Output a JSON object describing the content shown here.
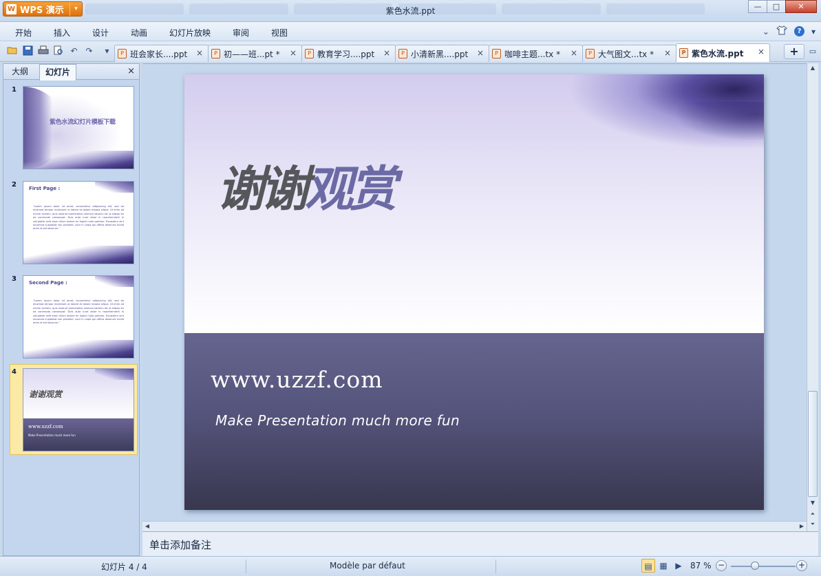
{
  "app": {
    "button_label": "WPS 演示",
    "logo_glyph": "W",
    "window_title": "紫色水流.ppt",
    "accent_color": "#e98a1f"
  },
  "window_controls": {
    "minimize": "—",
    "maximize": "□",
    "close": "✕"
  },
  "menu": {
    "items": [
      "开始",
      "插入",
      "设计",
      "动画",
      "幻灯片放映",
      "审阅",
      "视图"
    ],
    "right_chevron": "⌄",
    "skin_icon": "shirt-icon",
    "help_label": "?"
  },
  "doc_tabs": [
    {
      "label": "班会家长....ppt",
      "active": false
    },
    {
      "label": "初——班...pt *",
      "active": false
    },
    {
      "label": "教育学习....ppt",
      "active": false
    },
    {
      "label": "小清新黑....ppt",
      "active": false
    },
    {
      "label": "咖啡主题...tx *",
      "active": false
    },
    {
      "label": "大气图文...tx *",
      "active": false
    },
    {
      "label": "紫色水流.ppt",
      "active": true
    }
  ],
  "tab_close_glyph": "×",
  "left_panel": {
    "tabs": [
      "大纲",
      "幻灯片"
    ],
    "active_tab": "幻灯片",
    "close_glyph": "×",
    "slides": [
      {
        "number": "1",
        "title": "紫色水流幻灯片模板下载"
      },
      {
        "number": "2",
        "heading": "First Page :",
        "body": "\"Lorem ipsum dolor sit amet, consectetur adipisicing elit, sed do eiusmod tempor incididunt ut labore et dolore magna aliqua. Ut enim ad minim veniam, quis nostrud exercitation ullamco laboris nisi ut aliquip ex ea commodo consequat. Duis aute irure dolor in reprehenderit in voluptate velit esse cillum dolore eu fugiat nulla pariatur. Excepteur sint occaecat cupidatat non proident, sunt in culpa qui officia deserunt mollit anim id est laborum.\""
      },
      {
        "number": "3",
        "heading": "Second Page :",
        "body": "\"Lorem ipsum dolor sit amet, consectetur adipisicing elit, sed do eiusmod tempor incididunt ut labore et dolore magna aliqua. Ut enim ad minim veniam, quis nostrud exercitation ullamco laboris nisi ut aliquip ex ea commodo consequat. Duis aute irure dolor in reprehenderit in voluptate velit esse cillum dolore eu fugiat nulla pariatur. Excepteur sint occaecat cupidatat non proident, sunt in culpa qui officia deserunt mollit anim id est laborum.\""
      },
      {
        "number": "4",
        "title": "谢谢观赏",
        "url": "www.uzzf.com",
        "sub": "Make Presentation much more fun",
        "selected": true
      }
    ]
  },
  "slide": {
    "title_dark": "谢谢",
    "title_purple": "观赏",
    "url": "www.uzzf.com",
    "subtitle": "Make Presentation much more fun",
    "colors": {
      "title_dark": "#55575b",
      "title_purple": "#6c6aa5",
      "band_top": "#66658f",
      "band_bottom": "#38374f"
    }
  },
  "notes_placeholder": "单击添加备注",
  "status": {
    "slide_counter": "幻灯片 4 / 4",
    "template": "Modèle par défaut",
    "zoom": "87 %",
    "zoom_fraction": 0.37,
    "zoom_out": "−",
    "zoom_in": "+"
  }
}
